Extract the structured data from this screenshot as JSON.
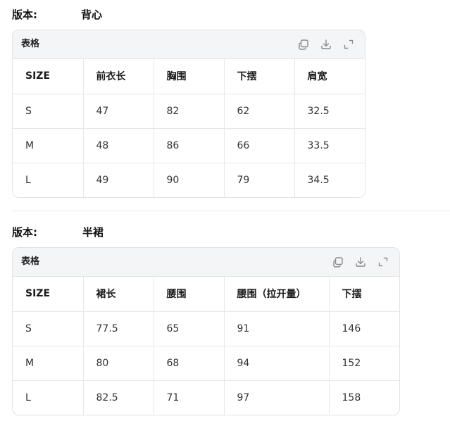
{
  "sections": [
    {
      "version_label": "版本:",
      "version_value": "背心",
      "table_title": "表格",
      "headers": [
        "SIZE",
        "前衣长",
        "胸围",
        "下摆",
        "肩宽"
      ],
      "rows": [
        [
          "S",
          "47",
          "82",
          "62",
          "32.5"
        ],
        [
          "M",
          "48",
          "86",
          "66",
          "33.5"
        ],
        [
          "L",
          "49",
          "90",
          "79",
          "34.5"
        ]
      ]
    },
    {
      "version_label": "版本:",
      "version_value": "半裙",
      "table_title": "表格",
      "headers": [
        "SIZE",
        "裙长",
        "腰围",
        "腰围（拉开量）",
        "下摆"
      ],
      "rows": [
        [
          "S",
          "77.5",
          "65",
          "91",
          "146"
        ],
        [
          "M",
          "80",
          "68",
          "94",
          "152"
        ],
        [
          "L",
          "82.5",
          "71",
          "97",
          "158"
        ]
      ]
    }
  ],
  "icons": {
    "copy": "copy-icon",
    "download": "download-icon",
    "expand": "expand-icon"
  },
  "colors": {
    "header_bg": "#f4f5f7",
    "border": "#e3e3e3",
    "icon": "#8a8a8a"
  }
}
